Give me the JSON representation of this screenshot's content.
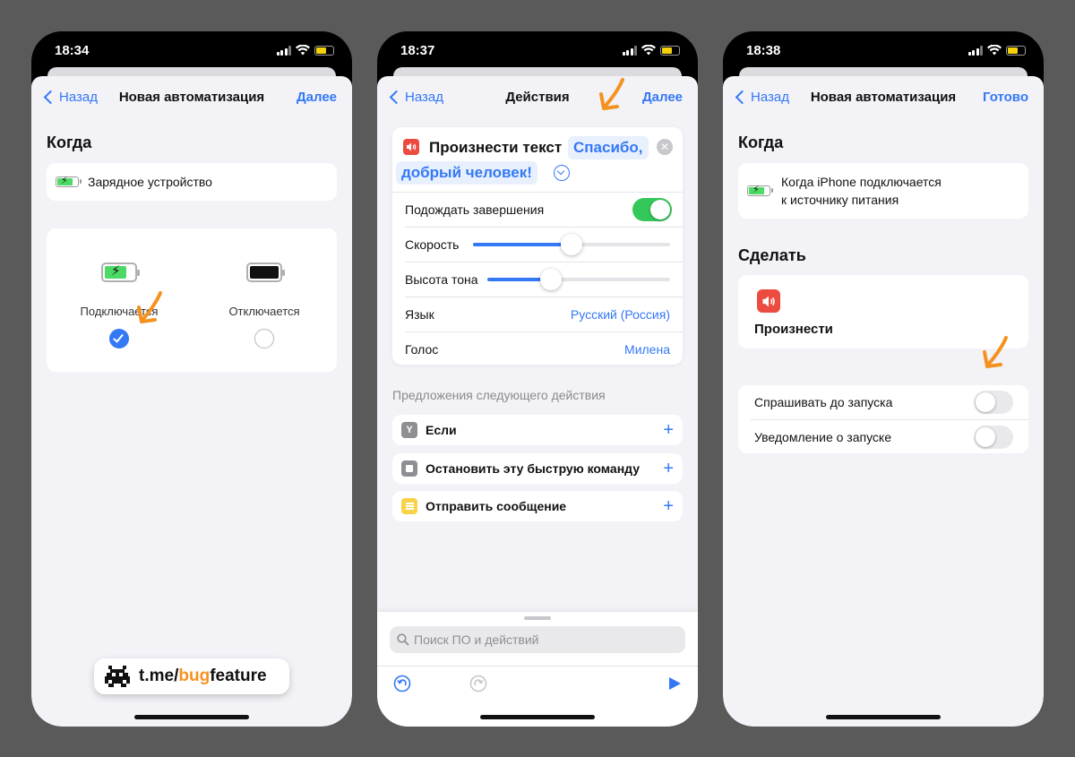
{
  "colors": {
    "accent": "#3478f6",
    "toggle_on": "#34c759",
    "background": "#5a5a5a",
    "arrow": "#f5921f",
    "speak_icon": "#ec4b3f"
  },
  "phones": [
    {
      "time": "18:34",
      "nav": {
        "back": "Назад",
        "title": "Новая автоматизация",
        "right": "Далее"
      },
      "when_heading": "Когда",
      "trigger_label": "Зарядное устройство",
      "options": [
        {
          "label": "Подключается",
          "selected": true
        },
        {
          "label": "Отключается",
          "selected": false
        }
      ],
      "watermark": "t.me/",
      "watermark_accent": "bug",
      "watermark_end": "feature"
    },
    {
      "time": "18:37",
      "nav": {
        "back": "Назад",
        "title": "Действия",
        "right": "Далее"
      },
      "action": {
        "title": "Произнести текст",
        "text_line1": "Спасибо,",
        "text_line2": "добрый человек!"
      },
      "params": [
        {
          "label": "Подождать завершения",
          "type": "toggle",
          "on": true
        },
        {
          "label": "Скорость",
          "type": "slider",
          "level": 0.5
        },
        {
          "label": "Высота тона",
          "type": "slider",
          "level": 0.35
        },
        {
          "label": "Язык",
          "type": "value",
          "value": "Русский (Россия)"
        },
        {
          "label": "Голос",
          "type": "value",
          "value": "Милена"
        }
      ],
      "suggestions_heading": "Предложения следующего действия",
      "suggestions": [
        {
          "label": "Если",
          "icon": "y-split-icon"
        },
        {
          "label": "Остановить эту быструю команду",
          "icon": "stop-icon"
        },
        {
          "label": "Отправить сообщение",
          "icon": "note-icon"
        }
      ],
      "search_placeholder": "Поиск ПО и действий"
    },
    {
      "time": "18:38",
      "nav": {
        "back": "Назад",
        "title": "Новая автоматизация",
        "right": "Готово"
      },
      "when_heading": "Когда",
      "trigger_line1": "Когда iPhone подключается",
      "trigger_line2": "к источнику питания",
      "do_heading": "Сделать",
      "do_action": "Произнести",
      "settings": [
        {
          "label": "Спрашивать до запуска",
          "on": false
        },
        {
          "label": "Уведомление о запуске",
          "on": false
        }
      ]
    }
  ]
}
